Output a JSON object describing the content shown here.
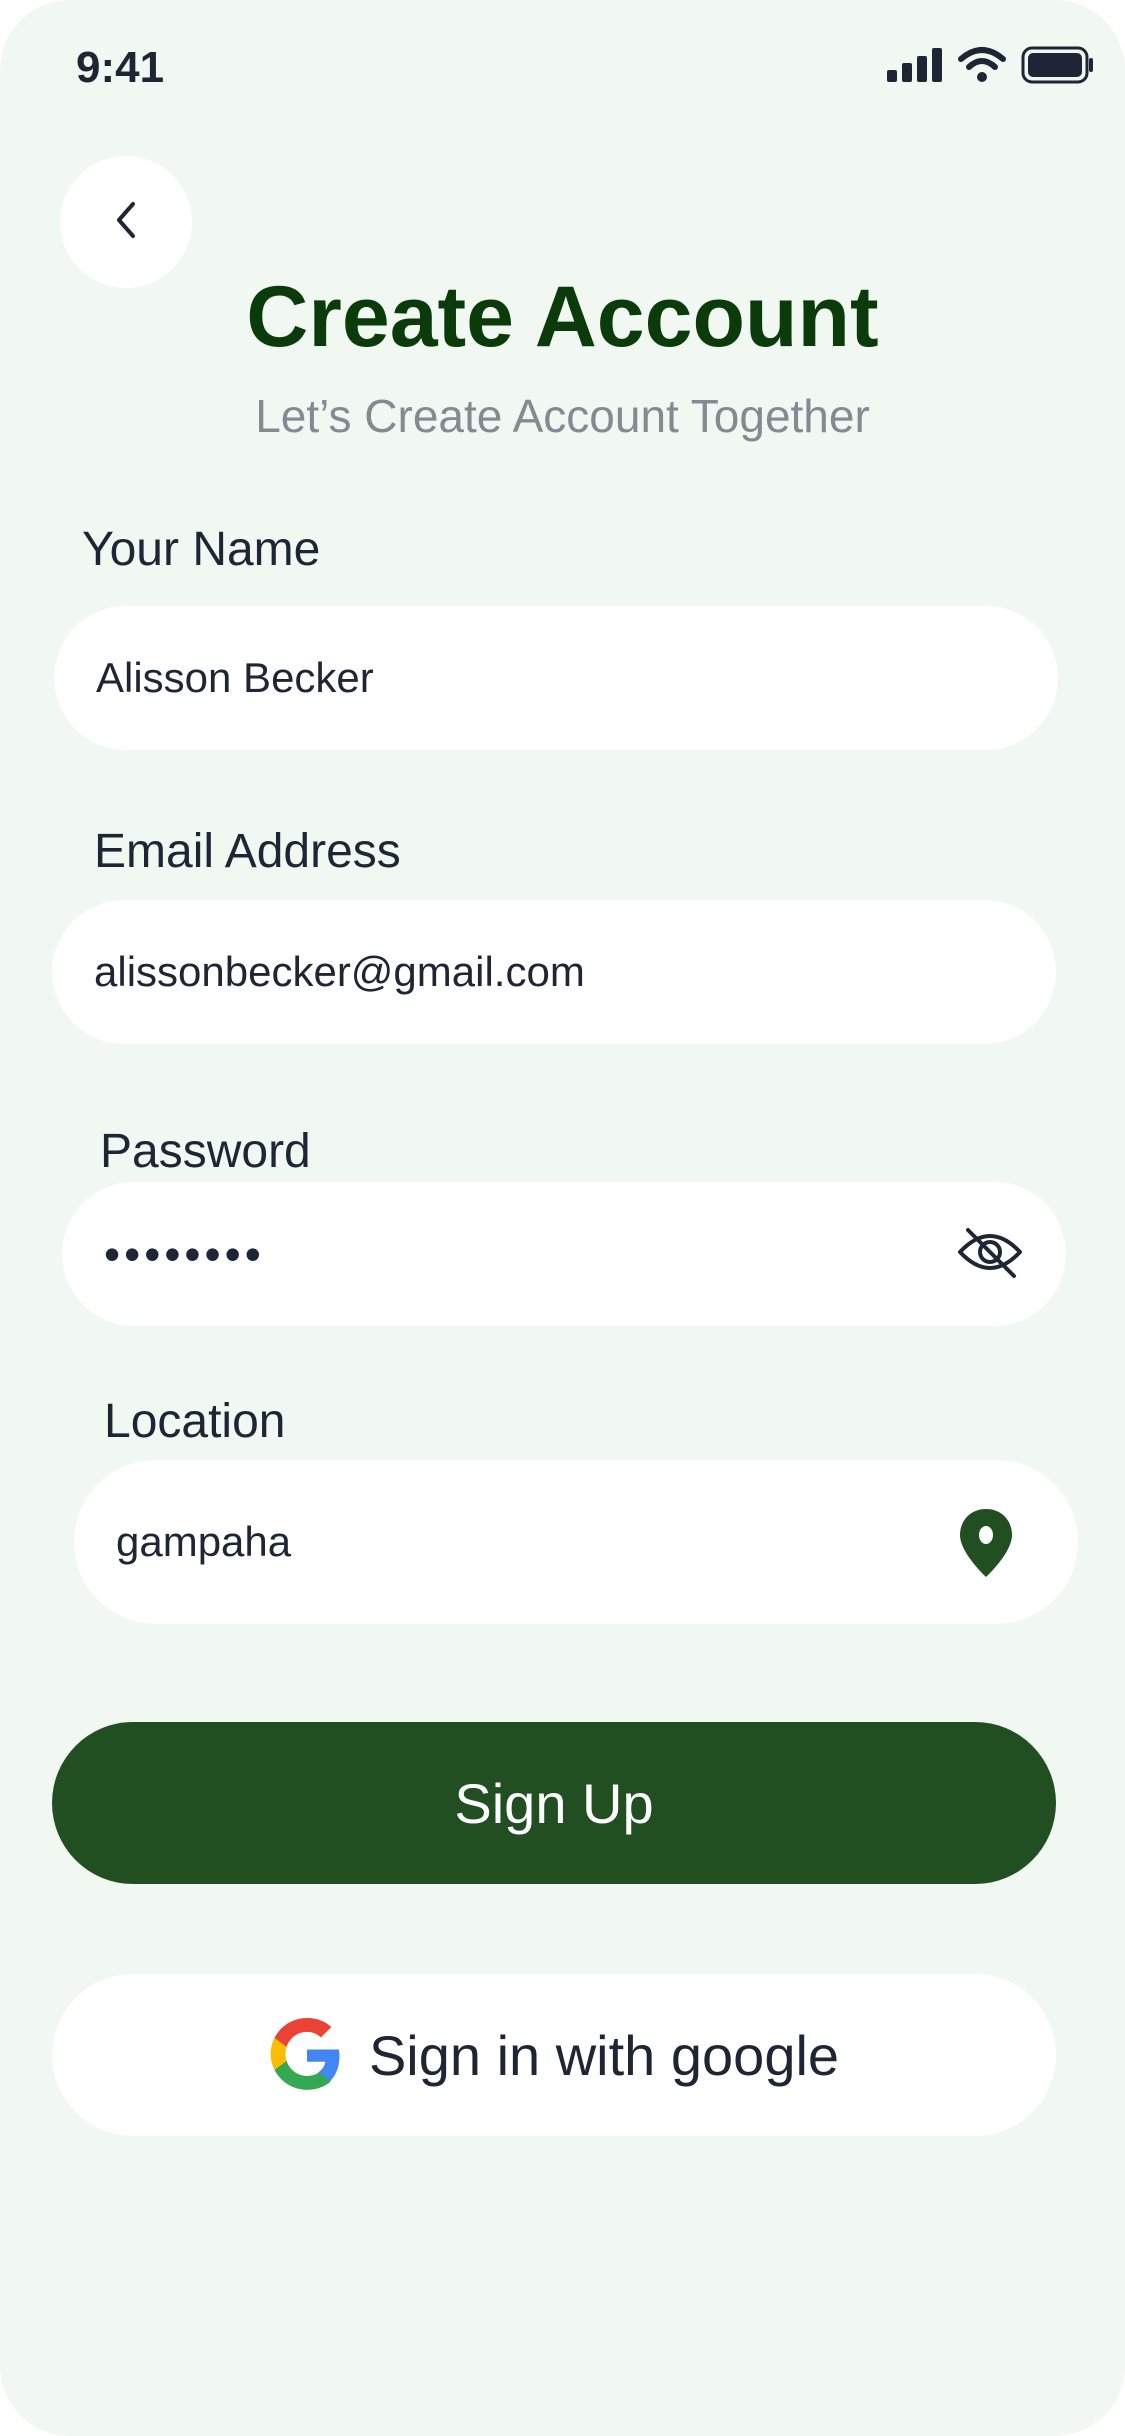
{
  "status_bar": {
    "time": "9:41",
    "icons": [
      "cellular-signal-icon",
      "wifi-icon",
      "battery-icon"
    ]
  },
  "header": {
    "back_icon": "chevron-left-icon",
    "title": "Create Account",
    "subtitle": "Let’s Create Account Together"
  },
  "form": {
    "name": {
      "label": "Your Name",
      "value": "Alisson Becker"
    },
    "email": {
      "label": "Email Address",
      "value": "alissonbecker@gmail.com"
    },
    "password": {
      "label": "Password",
      "value": "••••••••",
      "icon": "eye-off-icon"
    },
    "location": {
      "label": "Location",
      "value": "gampaha",
      "icon": "location-pin-icon"
    }
  },
  "actions": {
    "signup_label": "Sign Up",
    "google_label": "Sign in with google",
    "google_icon": "google-logo-icon"
  },
  "colors": {
    "background": "#f1f8f1",
    "title": "#0b3a0b",
    "primary": "#214f22",
    "pin": "#214f22",
    "text": "#1e2535",
    "subtitle": "#858a92"
  }
}
